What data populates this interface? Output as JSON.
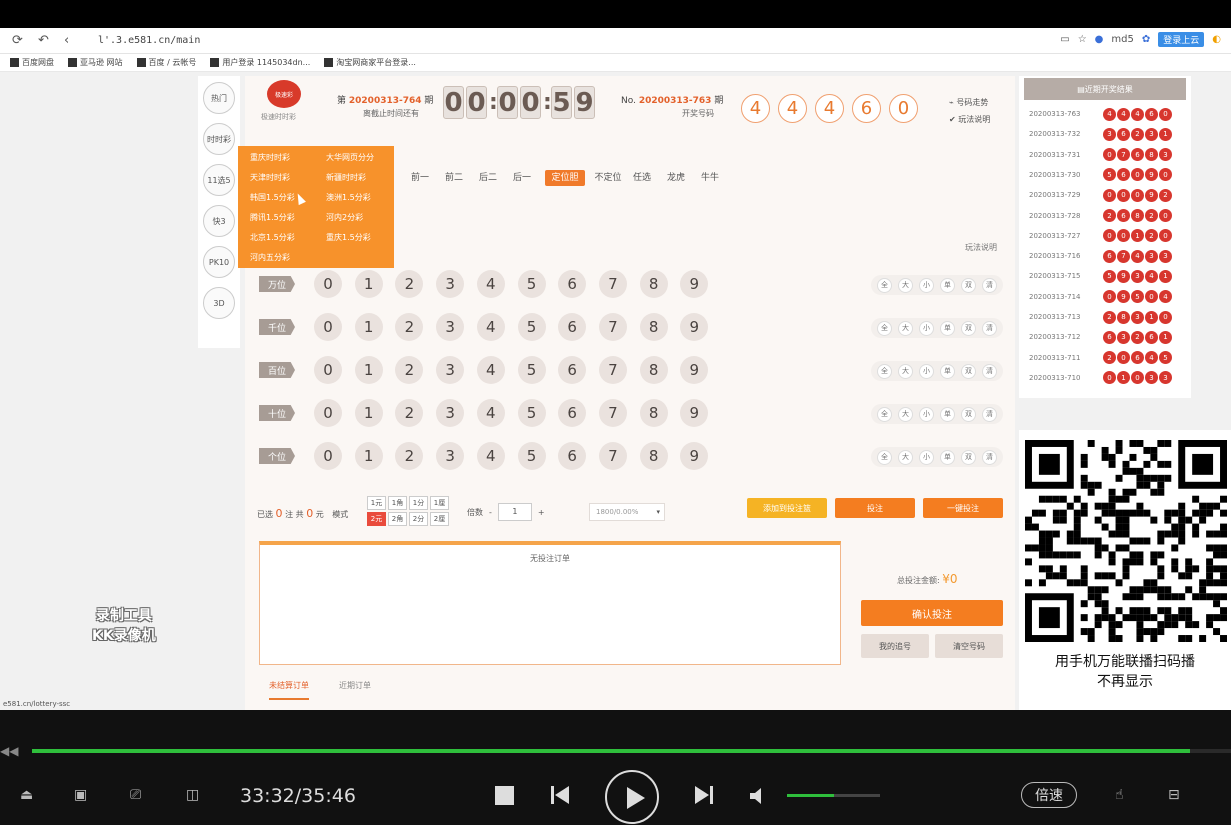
{
  "browser": {
    "url": "l'.3.e581.cn/main",
    "user": "md5",
    "login_chip": "登录上云",
    "bookmarks": [
      "百度网盘",
      "亚马逊 网站",
      "百度 / 云帐号",
      "用户登录 1145034dn...",
      "淘宝网商家平台登录..."
    ],
    "status_url": "e581.cn/lottery-ssc"
  },
  "left_nav": [
    "热门",
    "时时彩",
    "11选5",
    "快3",
    "PK10",
    "3D"
  ],
  "header": {
    "logo_text": "极速彩",
    "logo_sub": "极速时时彩",
    "issue_prefix": "第",
    "issue_no": "20200313-764",
    "issue_suffix": "期",
    "issue_sub": "离截止时间还有",
    "countdown": [
      "0",
      "0",
      "0",
      "0",
      "5",
      "9"
    ],
    "draw_prefix": "No.",
    "draw_no": "20200313-763",
    "draw_suffix": "期",
    "draw_sub": "开奖号码",
    "last_balls": [
      "4",
      "4",
      "4",
      "6",
      "0"
    ],
    "trend_link": "号码走势",
    "check_link": "玩法说明"
  },
  "tabs": [
    "前一",
    "前二",
    "后二",
    "后一",
    "定位胆",
    "不定位",
    "任选",
    "龙虎",
    "牛牛"
  ],
  "active_tab_index": 4,
  "rule_link": "玩法说明",
  "dropdown": {
    "col1": [
      "重庆时时彩",
      "天津时时彩",
      "韩国1.5分彩",
      "腾讯1.5分彩",
      "北京1.5分彩",
      "河内五分彩"
    ],
    "col2": [
      "大华网页分分",
      "新疆时时彩",
      "澳洲1.5分彩",
      "河内2分彩",
      "重庆1.5分彩"
    ]
  },
  "positions": [
    "万位",
    "千位",
    "百位",
    "十位",
    "个位"
  ],
  "digits": [
    "0",
    "1",
    "2",
    "3",
    "4",
    "5",
    "6",
    "7",
    "8",
    "9"
  ],
  "filters": [
    "全",
    "大",
    "小",
    "单",
    "双",
    "清"
  ],
  "bet_bar": {
    "count_label": "已选",
    "count": "0",
    "count_unit": "注 共",
    "amount": "0",
    "amount_unit": "元",
    "mode_label": "模式",
    "units": [
      "1元",
      "1角",
      "1分",
      "1厘",
      "2元",
      "2角",
      "2分",
      "2厘"
    ],
    "active_unit_index": 4,
    "mult_label": "倍数",
    "mult_minus": "-",
    "mult_value": "1",
    "mult_plus": "+",
    "rate": "1800/0.00%",
    "add_btn": "添加到投注篮",
    "bet_btn": "投注",
    "fast_btn": "一键投注"
  },
  "order": {
    "empty_text": "无投注订单",
    "total_label": "总投注金额:",
    "total_amount": "¥0",
    "confirm_btn": "确认投注",
    "mine_btn": "我的追号",
    "clear_btn": "清空号码",
    "tabs": [
      "未结算订单",
      "近期订单"
    ]
  },
  "history": {
    "button": "近期开奖结果",
    "rows": [
      {
        "issue": "20200313-763",
        "balls": [
          "4",
          "4",
          "4",
          "6",
          "0"
        ]
      },
      {
        "issue": "20200313-732",
        "balls": [
          "3",
          "6",
          "2",
          "3",
          "1"
        ]
      },
      {
        "issue": "20200313-731",
        "balls": [
          "0",
          "7",
          "6",
          "8",
          "3"
        ]
      },
      {
        "issue": "20200313-730",
        "balls": [
          "5",
          "6",
          "0",
          "9",
          "0"
        ]
      },
      {
        "issue": "20200313-729",
        "balls": [
          "0",
          "0",
          "0",
          "9",
          "2"
        ]
      },
      {
        "issue": "20200313-728",
        "balls": [
          "2",
          "6",
          "8",
          "2",
          "0"
        ]
      },
      {
        "issue": "20200313-727",
        "balls": [
          "0",
          "0",
          "1",
          "2",
          "0"
        ]
      },
      {
        "issue": "20200313-716",
        "balls": [
          "6",
          "7",
          "4",
          "3",
          "3"
        ]
      },
      {
        "issue": "20200313-715",
        "balls": [
          "5",
          "9",
          "3",
          "4",
          "1"
        ]
      },
      {
        "issue": "20200313-714",
        "balls": [
          "0",
          "9",
          "5",
          "0",
          "4"
        ]
      },
      {
        "issue": "20200313-713",
        "balls": [
          "2",
          "8",
          "3",
          "1",
          "0"
        ]
      },
      {
        "issue": "20200313-712",
        "balls": [
          "6",
          "3",
          "2",
          "6",
          "1"
        ]
      },
      {
        "issue": "20200313-711",
        "balls": [
          "2",
          "0",
          "6",
          "4",
          "5"
        ]
      },
      {
        "issue": "20200313-710",
        "balls": [
          "0",
          "1",
          "0",
          "3",
          "3"
        ]
      }
    ]
  },
  "overlay": {
    "watermark_line1": "录制工具",
    "watermark_line2": "KK录像机",
    "qr_text_line1": "用手机万能联播扫码播",
    "qr_text_line2": "不再显示"
  },
  "player": {
    "time": "33:32/35:46",
    "progress": 0.966,
    "volume": 0.5,
    "speed_label": "倍速"
  }
}
